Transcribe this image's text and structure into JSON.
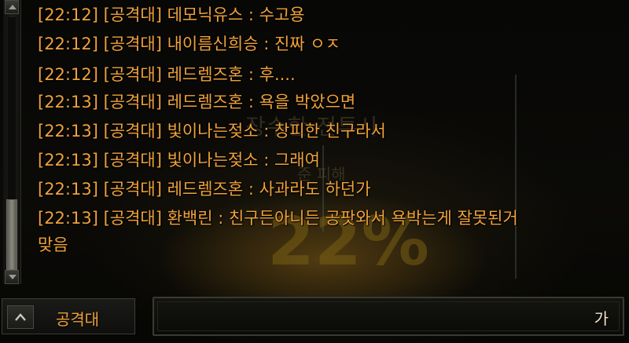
{
  "background": {
    "title": "장수한 전투사",
    "subtitle": "준 피해",
    "percent": "22%"
  },
  "chat": {
    "lines": [
      "[22:12] [공격대] 데모닉유스 : 수고용",
      "[22:12] [공격대] 내이름신희승 : 진짜 ㅇㅈ",
      "[22:12] [공격대] 레드렘즈혼 : 후....",
      "[22:13] [공격대] 레드렘즈혼 : 욕을 박았으면",
      "[22:13] [공격대] 빛이나는젖소 : 창피한 친구라서",
      "[22:13] [공격대] 빛이나는젖소 : 그래여",
      "[22:13] [공격대] 레드렘즈혼 : 사과라도 하던가",
      "[22:13] [공격대] 환백린 : 친구든아니든 공팟와서 욕박는게 잘못된거",
      "맞음"
    ]
  },
  "input": {
    "channel_label": "공격대",
    "ime_mode": "가"
  },
  "colors": {
    "chat_text": "#f0a23a",
    "background": "#050504"
  },
  "icons": {
    "scroll_up": "scroll-up-arrow-icon",
    "scroll_down": "scroll-down-arrow-icon",
    "channel_toggle": "chevron-up-icon"
  }
}
